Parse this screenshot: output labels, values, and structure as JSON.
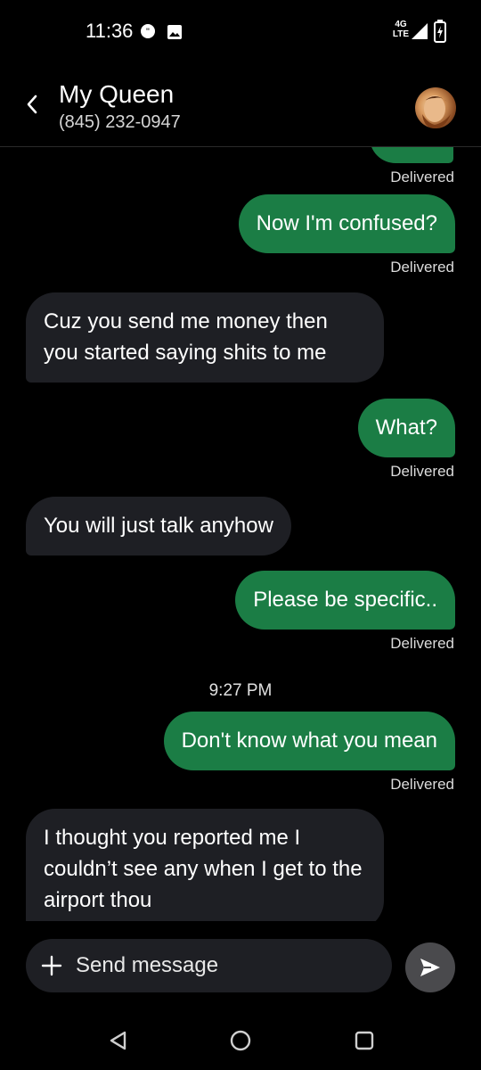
{
  "status_bar": {
    "time": "11:36",
    "network": "4G LTE",
    "icons": [
      "chat-notification-icon",
      "photo-notification-icon",
      "signal-icon",
      "battery-charging-icon"
    ]
  },
  "header": {
    "back_icon": "chevron-left-icon",
    "contact_name": "My Queen",
    "contact_phone": "(845) 232-0947"
  },
  "messages": [
    {
      "direction": "out",
      "status": "Delivered"
    },
    {
      "direction": "out",
      "text": "Now I'm confused?",
      "status": "Delivered"
    },
    {
      "direction": "in",
      "text": "Cuz you send me money then you started saying shits to me"
    },
    {
      "direction": "out",
      "text": "What?",
      "status": "Delivered"
    },
    {
      "direction": "in",
      "text": "You will just talk anyhow"
    },
    {
      "direction": "out",
      "text": "Please be specific..",
      "status": "Delivered"
    },
    {
      "timestamp": "9:27 PM"
    },
    {
      "direction": "out",
      "text": "Don't know what you mean",
      "status": "Delivered"
    },
    {
      "direction": "in",
      "text": "I thought you reported me I couldn’t see any when I get to the airport thou"
    }
  ],
  "composer": {
    "placeholder": "Send message",
    "add_icon": "plus-icon",
    "send_icon": "send-icon"
  },
  "nav_bar": {
    "icons": [
      "back-triangle-icon",
      "home-circle-icon",
      "recents-square-icon"
    ]
  },
  "colors": {
    "outgoing_bubble": "#1b7d45",
    "incoming_bubble": "#1e1f24",
    "background": "#000000"
  }
}
